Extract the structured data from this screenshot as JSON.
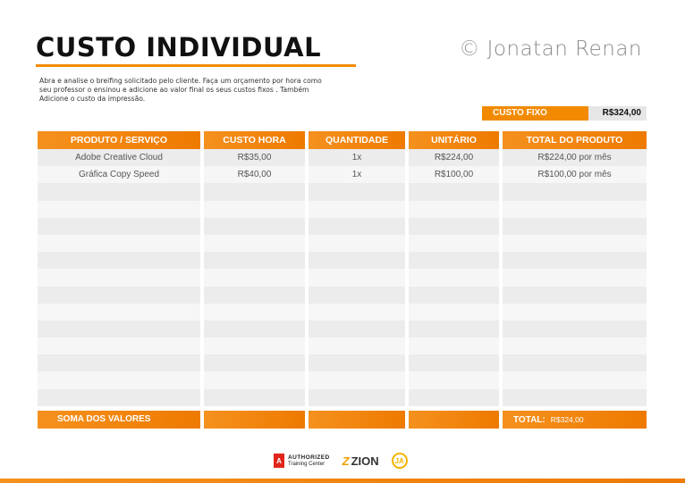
{
  "header": {
    "title": "CUSTO INDIVIDUAL",
    "author": "© Jonatan Renan",
    "instructions": "Abra e analise o breifing solicitado pelo cliente. Faça um orçamento por hora como seu professor o ensinou e adicione ao valor final os seus custos fixos . Também Adicione o custo da impressão."
  },
  "fixed_cost": {
    "label": "CUSTO FIXO",
    "value": "R$324,00"
  },
  "table": {
    "columns": [
      "PRODUTO / SERVIÇO",
      "CUSTO HORA",
      "QUANTIDADE",
      "UNITÁRIO",
      "TOTAL DO PRODUTO"
    ],
    "rows": [
      [
        "Adobe Creative Cloud",
        "R$35,00",
        "1x",
        "R$224,00",
        "R$224,00 por mês"
      ],
      [
        "Gráfica Copy Speed",
        "R$40,00",
        "1x",
        "R$100,00",
        "R$100,00 por mês"
      ],
      [
        "",
        "",
        "",
        "",
        ""
      ],
      [
        "",
        "",
        "",
        "",
        ""
      ],
      [
        "",
        "",
        "",
        "",
        ""
      ],
      [
        "",
        "",
        "",
        "",
        ""
      ],
      [
        "",
        "",
        "",
        "",
        ""
      ],
      [
        "",
        "",
        "",
        "",
        ""
      ],
      [
        "",
        "",
        "",
        "",
        ""
      ],
      [
        "",
        "",
        "",
        "",
        ""
      ],
      [
        "",
        "",
        "",
        "",
        ""
      ],
      [
        "",
        "",
        "",
        "",
        ""
      ],
      [
        "",
        "",
        "",
        "",
        ""
      ],
      [
        "",
        "",
        "",
        "",
        ""
      ],
      [
        "",
        "",
        "",
        "",
        ""
      ]
    ],
    "footer": {
      "label": "SOMA DOS VALORES",
      "total_label": "TOTAL:",
      "total_value": "R$324,00"
    }
  },
  "logos": {
    "adobe_mark": "A",
    "adobe_line1": "AUTHORIZED",
    "adobe_line2": "Training Center",
    "zion_z": "Z",
    "zion_name": "ZION",
    "badge": "JA"
  },
  "colors": {
    "accent": "#f28a00",
    "row_dark": "#ececec",
    "row_light": "#f6f6f6"
  }
}
